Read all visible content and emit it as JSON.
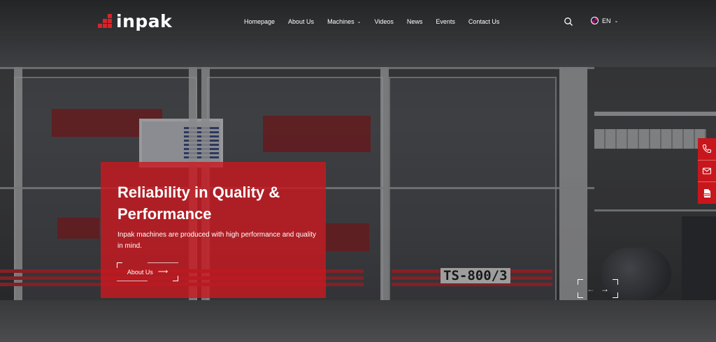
{
  "brand": {
    "logo_text": "inpak"
  },
  "nav": {
    "items": [
      {
        "label": "Homepage"
      },
      {
        "label": "About Us"
      },
      {
        "label": "Machines",
        "dropdown": true
      },
      {
        "label": "Videos"
      },
      {
        "label": "News"
      },
      {
        "label": "Events"
      },
      {
        "label": "Contact Us"
      }
    ],
    "search_icon": "search-icon",
    "language": {
      "code": "EN",
      "flag_icon": "uk-flag-icon"
    }
  },
  "hero": {
    "title": "Reliability in Quality & Performance",
    "description": "Inpak machines are produced with high performance and quality in mind.",
    "button_label": "About Us",
    "button_icon": "arrow-right-icon"
  },
  "background": {
    "machine_label": "TS-800/3"
  },
  "slider": {
    "prev_icon": "arrow-left-icon",
    "next_icon": "arrow-right-icon"
  },
  "side_contact": {
    "items": [
      {
        "icon": "phone-icon"
      },
      {
        "icon": "mail-icon"
      },
      {
        "icon": "pdf-icon"
      }
    ]
  },
  "colors": {
    "accent": "#c8161d",
    "text": "#ffffff"
  }
}
